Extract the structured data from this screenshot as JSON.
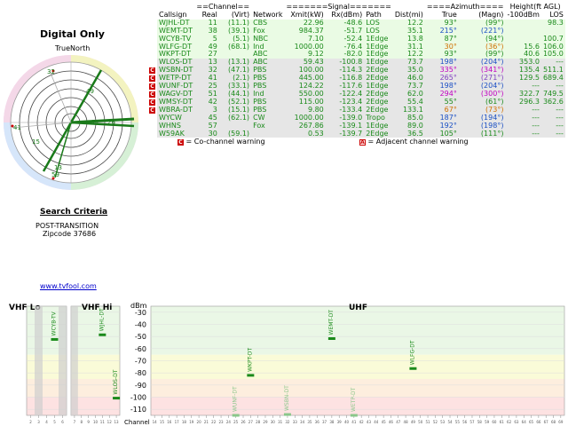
{
  "left_panel": {
    "title": "Digital Only",
    "true_north": "TrueNorth",
    "polar_labels": [
      "32",
      "49",
      "41",
      "11",
      "26",
      "13",
      "15",
      "59"
    ],
    "search_title": "Search Criteria",
    "search_line1": "POST-TRANSITION",
    "search_line2": "Zipcode 37686",
    "link": "www.tvfool.com"
  },
  "table": {
    "group_headers": [
      "==Channel==",
      "=======Signal=======",
      "====Azimuth====",
      "Height(ft AGL)"
    ],
    "columns": [
      "Callsign",
      "Real",
      "(Virt)",
      "Network",
      "Xmit(kW)",
      "Rx(dBm)",
      "Path",
      "Dist(mi)",
      "True",
      "(Magn)",
      "-100dBm",
      "LOS"
    ],
    "rows": [
      {
        "callsign": "WJHL-DT",
        "real": "11",
        "virt": "(11.1)",
        "network": "CBS",
        "xmit": "22.96",
        "rx": "-48.6",
        "path": "LOS",
        "dist": "12.2",
        "true": "93°",
        "magn": "(99°)",
        "h100": "",
        "los": "98.3",
        "badge": "",
        "style": "green",
        "aztrue": "#1a8a1a"
      },
      {
        "callsign": "WEMT-DT",
        "real": "38",
        "virt": "(39.1)",
        "network": "Fox",
        "xmit": "984.37",
        "rx": "-51.7",
        "path": "LOS",
        "dist": "35.1",
        "true": "215°",
        "magn": "(221°)",
        "h100": "",
        "los": "",
        "badge": "",
        "style": "green",
        "aztrue": "#1a4fc4"
      },
      {
        "callsign": "WCYB-TV",
        "real": "5",
        "virt": "(5.1)",
        "network": "NBC",
        "xmit": "7.10",
        "rx": "-52.4",
        "path": "1Edge",
        "dist": "13.8",
        "true": "87°",
        "magn": "(94°)",
        "h100": "",
        "los": "100.7",
        "badge": "",
        "style": "green",
        "aztrue": "#1a8a1a"
      },
      {
        "callsign": "WLFG-DT",
        "real": "49",
        "virt": "(68.1)",
        "network": "Ind",
        "xmit": "1000.00",
        "rx": "-76.4",
        "path": "1Edge",
        "dist": "31.1",
        "true": "30°",
        "magn": "(36°)",
        "h100": "15.6",
        "los": "106.0",
        "badge": "",
        "style": "green",
        "aztrue": "#d07000"
      },
      {
        "callsign": "WKPT-DT",
        "real": "27",
        "virt": "",
        "network": "ABC",
        "xmit": "9.12",
        "rx": "-82.0",
        "path": "1Edge",
        "dist": "12.2",
        "true": "93°",
        "magn": "(99°)",
        "h100": "40.6",
        "los": "105.0",
        "badge": "",
        "style": "green",
        "aztrue": "#1a8a1a"
      },
      {
        "callsign": "WLOS-DT",
        "real": "13",
        "virt": "(13.1)",
        "network": "ABC",
        "xmit": "59.43",
        "rx": "-100.8",
        "path": "1Edge",
        "dist": "73.7",
        "true": "198°",
        "magn": "(204°)",
        "h100": "353.0",
        "los": "---",
        "badge": "",
        "style": "gray",
        "aztrue": "#1a4fc4"
      },
      {
        "callsign": "WSBN-DT",
        "real": "32",
        "virt": "(47.1)",
        "network": "PBS",
        "xmit": "100.00",
        "rx": "-114.3",
        "path": "2Edge",
        "dist": "35.0",
        "true": "335°",
        "magn": "(341°)",
        "h100": "135.4",
        "los": "511.1",
        "badge": "C",
        "style": "gray",
        "aztrue": "#c000c0"
      },
      {
        "callsign": "WETP-DT",
        "real": "41",
        "virt": "(2.1)",
        "network": "PBS",
        "xmit": "445.00",
        "rx": "-116.8",
        "path": "2Edge",
        "dist": "46.0",
        "true": "265°",
        "magn": "(271°)",
        "h100": "129.5",
        "los": "689.4",
        "badge": "C",
        "style": "gray",
        "aztrue": "#8040c0"
      },
      {
        "callsign": "WUNF-DT",
        "real": "25",
        "virt": "(33.1)",
        "network": "PBS",
        "xmit": "124.22",
        "rx": "-117.6",
        "path": "1Edge",
        "dist": "73.7",
        "true": "198°",
        "magn": "(204°)",
        "h100": "---",
        "los": "---",
        "badge": "C",
        "style": "gray",
        "aztrue": "#1a4fc4"
      },
      {
        "callsign": "WAGV-DT",
        "real": "51",
        "virt": "(44.1)",
        "network": "Ind",
        "xmit": "550.00",
        "rx": "-122.4",
        "path": "2Edge",
        "dist": "62.0",
        "true": "294°",
        "magn": "(300°)",
        "h100": "322.7",
        "los": "749.5",
        "badge": "C",
        "style": "gray",
        "aztrue": "#c000c0"
      },
      {
        "callsign": "WMSY-DT",
        "real": "42",
        "virt": "(52.1)",
        "network": "PBS",
        "xmit": "115.00",
        "rx": "-123.4",
        "path": "2Edge",
        "dist": "55.4",
        "true": "55°",
        "magn": "(61°)",
        "h100": "296.3",
        "los": "362.6",
        "badge": "C",
        "style": "gray",
        "aztrue": "#1a8a1a"
      },
      {
        "callsign": "WBRA-DT",
        "real": "3",
        "virt": "(15.1)",
        "network": "PBS",
        "xmit": "9.80",
        "rx": "-133.4",
        "path": "2Edge",
        "dist": "133.1",
        "true": "67°",
        "magn": "(73°)",
        "h100": "---",
        "los": "---",
        "badge": "C",
        "style": "gray",
        "aztrue": "#d07000"
      },
      {
        "callsign": "WYCW",
        "real": "45",
        "virt": "(62.1)",
        "network": "CW",
        "xmit": "1000.00",
        "rx": "-139.0",
        "path": "Tropo",
        "dist": "85.0",
        "true": "187°",
        "magn": "(194°)",
        "h100": "---",
        "los": "---",
        "badge": "",
        "style": "gray",
        "aztrue": "#1a4fc4"
      },
      {
        "callsign": "WHNS",
        "real": "57",
        "virt": "",
        "network": "Fox",
        "xmit": "267.86",
        "rx": "-139.1",
        "path": "1Edge",
        "dist": "89.0",
        "true": "192°",
        "magn": "(198°)",
        "h100": "---",
        "los": "---",
        "badge": "",
        "style": "gray",
        "aztrue": "#1a4fc4"
      },
      {
        "callsign": "W59AK",
        "real": "30",
        "virt": "(59.1)",
        "network": "",
        "xmit": "0.53",
        "rx": "-139.7",
        "path": "2Edge",
        "dist": "36.5",
        "true": "105°",
        "magn": "(111°)",
        "h100": "---",
        "los": "---",
        "badge": "",
        "style": "gray",
        "aztrue": "#1a8a1a"
      }
    ],
    "legend_cochannel": "= Co-channel warning",
    "legend_adjacent": "= Adjacent channel warning",
    "legend_c": "C",
    "legend_a": "A"
  },
  "bands": {
    "vhf_lo_title": "VHF Lo",
    "vhf_hi_title": "VHF Hi",
    "uhf_title": "UHF",
    "dbm_label": "dBm",
    "channel_label": "Channel",
    "y_ticks": [
      "-30",
      "-40",
      "-50",
      "-60",
      "-70",
      "-80",
      "-90",
      "-100",
      "-110"
    ]
  },
  "chart_data": {
    "type": "bar",
    "ylabel": "dBm",
    "xlabel": "Channel",
    "ylim": [
      -115,
      -25
    ],
    "vhf_lo": {
      "channels": [
        2,
        3,
        4,
        5,
        6
      ],
      "stations": [
        {
          "callsign": "WCYB-TV",
          "channel": 5,
          "dbm": -52.4,
          "color": "#1a8a1a"
        }
      ],
      "shaded": [
        3,
        6
      ]
    },
    "vhf_hi": {
      "channels": [
        7,
        8,
        9,
        10,
        11,
        12,
        13
      ],
      "stations": [
        {
          "callsign": "WJHL-DT",
          "channel": 11,
          "dbm": -48.6,
          "color": "#1a8a1a"
        },
        {
          "callsign": "WLOS-DT",
          "channel": 13,
          "dbm": -100.8,
          "color": "#1a8a1a"
        }
      ],
      "shaded": [
        7
      ]
    },
    "uhf": {
      "channels": [
        14,
        15,
        16,
        17,
        18,
        19,
        20,
        21,
        22,
        23,
        24,
        25,
        26,
        27,
        28,
        29,
        30,
        31,
        32,
        33,
        34,
        35,
        36,
        37,
        38,
        39,
        40,
        41,
        42,
        43,
        44,
        45,
        46,
        47,
        48,
        49,
        50,
        51,
        52,
        53,
        54,
        55,
        56,
        57,
        58,
        59,
        60,
        61,
        62,
        63,
        64,
        65,
        66,
        67,
        68,
        69
      ],
      "stations": [
        {
          "callsign": "WUNF-DT",
          "channel": 25,
          "dbm": -117.6,
          "color": "#8ac78a"
        },
        {
          "callsign": "WKPT-DT",
          "channel": 27,
          "dbm": -82.0,
          "color": "#1a8a1a"
        },
        {
          "callsign": "WSBN-DT",
          "channel": 32,
          "dbm": -114.3,
          "color": "#8ac78a"
        },
        {
          "callsign": "WEMT-DT",
          "channel": 38,
          "dbm": -51.7,
          "color": "#1a8a1a"
        },
        {
          "callsign": "WETP-DT",
          "channel": 41,
          "dbm": -116.8,
          "color": "#8ac78a"
        },
        {
          "callsign": "WLFG-DT",
          "channel": 49,
          "dbm": -76.4,
          "color": "#1a8a1a"
        }
      ]
    }
  }
}
